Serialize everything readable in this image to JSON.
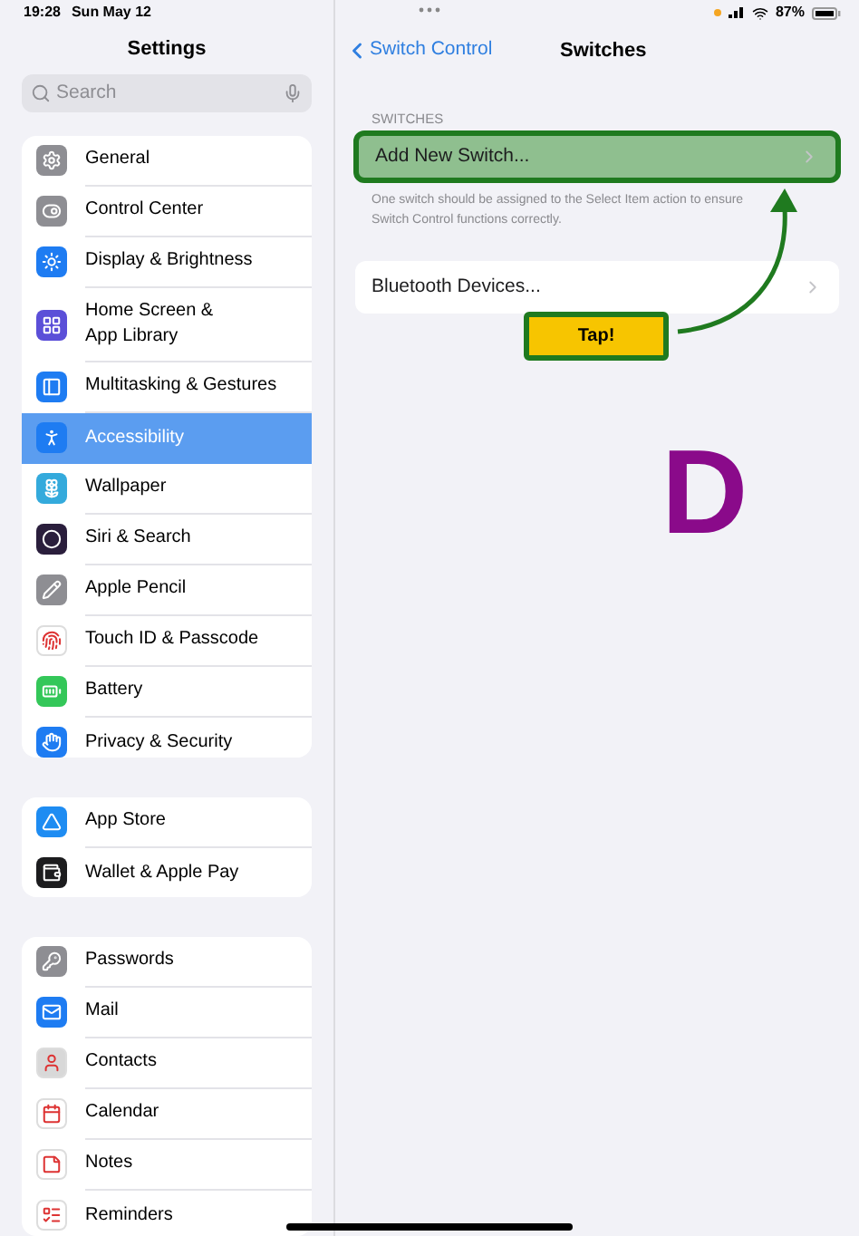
{
  "status_bar": {
    "time": "19:28",
    "date": "Sun May 12",
    "battery": "87%"
  },
  "sidebar": {
    "title": "Settings",
    "search": {
      "placeholder": "Search"
    },
    "groups": [
      {
        "items": [
          {
            "label": "General",
            "selected": false,
            "color": "#8e8e93"
          },
          {
            "label": "Control Center",
            "selected": false,
            "color": "#8e8e93"
          },
          {
            "label": "Display & Brightness",
            "selected": false,
            "color": "#1e7cf2"
          },
          {
            "label": "Home Screen & App Library",
            "selected": false,
            "color": "#5b4fd8"
          },
          {
            "label": "Multitasking & Gestures",
            "selected": false,
            "color": "#1e7cf2"
          },
          {
            "label": "Accessibility",
            "selected": true,
            "color": "#1e7cf2"
          },
          {
            "label": "Wallpaper",
            "selected": false,
            "color": "#34aadc"
          },
          {
            "label": "Siri & Search",
            "selected": false,
            "color": "#2a1e3c"
          },
          {
            "label": "Apple Pencil",
            "selected": false,
            "color": "#8e8e93"
          },
          {
            "label": "Touch ID & Passcode",
            "selected": false,
            "color": "#ffffff"
          },
          {
            "label": "Battery",
            "selected": false,
            "color": "#34c759"
          },
          {
            "label": "Privacy & Security",
            "selected": false,
            "color": "#1e7cf2"
          }
        ]
      },
      {
        "items": [
          {
            "label": "App Store",
            "selected": false,
            "color": "#1e8cf2"
          },
          {
            "label": "Wallet & Apple Pay",
            "selected": false,
            "color": "#1c1c1e"
          }
        ]
      },
      {
        "items": [
          {
            "label": "Passwords",
            "selected": false,
            "color": "#8e8e93"
          },
          {
            "label": "Mail",
            "selected": false,
            "color": "#1e7cf2"
          },
          {
            "label": "Contacts",
            "selected": false,
            "color": "#d8d8d8"
          },
          {
            "label": "Calendar",
            "selected": false,
            "color": "#ffffff"
          },
          {
            "label": "Notes",
            "selected": false,
            "color": "#ffffff"
          },
          {
            "label": "Reminders",
            "selected": false,
            "color": "#ffffff"
          }
        ]
      }
    ]
  },
  "detail": {
    "back": "Switch Control",
    "title": "Switches",
    "section_header": "SWITCHES",
    "switch_rows": [
      {
        "label": "Add New Switch...",
        "highlighted": true
      }
    ],
    "footer": "One switch should be assigned to the Select Item action to ensure Switch Control functions correctly.",
    "other_rows": [
      {
        "label": "Bluetooth Devices...",
        "highlighted": false
      }
    ]
  },
  "annotation": {
    "callout": "Tap!",
    "letter": "D"
  }
}
